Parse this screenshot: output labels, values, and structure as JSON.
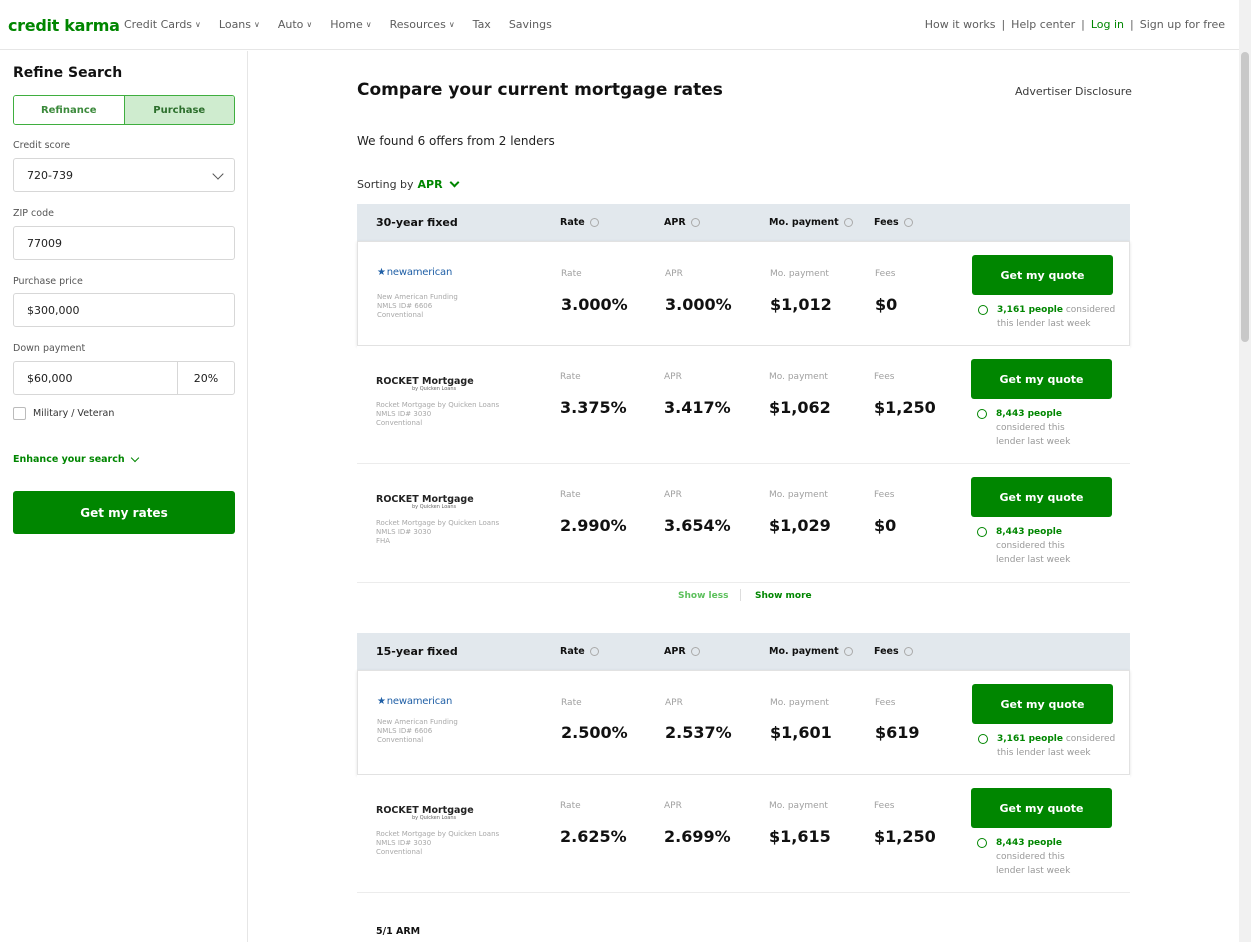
{
  "nav": {
    "logo": "credit karma",
    "items": [
      {
        "label": "Credit Cards",
        "dropdown": true
      },
      {
        "label": "Loans",
        "dropdown": true
      },
      {
        "label": "Auto",
        "dropdown": true
      },
      {
        "label": "Home",
        "dropdown": true
      },
      {
        "label": "Resources",
        "dropdown": true
      },
      {
        "label": "Tax",
        "dropdown": false
      },
      {
        "label": "Savings",
        "dropdown": false
      }
    ],
    "how_it_works": "How it works",
    "help_center": "Help center",
    "login": "Log in",
    "signup": "Sign up for free"
  },
  "sidebar": {
    "title": "Refine Search",
    "toggle_refinance": "Refinance",
    "toggle_purchase": "Purchase",
    "credit_score_label": "Credit score",
    "credit_score_value": "720-739",
    "zip_label": "ZIP code",
    "zip_value": "77009",
    "price_label": "Purchase price",
    "price_value": "$300,000",
    "down_label": "Down payment",
    "down_value": "$60,000",
    "down_pct": "20%",
    "military_label": "Military / Veteran",
    "enhance_label": "Enhance your search",
    "submit_label": "Get my rates"
  },
  "main": {
    "title": "Compare your current mortgage rates",
    "disclosure": "Advertiser Disclosure",
    "found_text": "We found 6 offers from 2 lenders",
    "sorting_label": "Sorting by",
    "sorting_value": "APR",
    "col_rate": "Rate",
    "col_apr": "APR",
    "col_payment": "Mo. payment",
    "col_fees": "Fees",
    "quote_label": "Get my quote",
    "show_less": "Show less",
    "show_more": "Show more",
    "arm_title": "5/1 ARM",
    "sections": [
      {
        "title": "30-year fixed",
        "offers": [
          {
            "logo": "newamerican",
            "lender": "New American Funding",
            "nmls": "NMLS ID# 6606",
            "loan_type": "Conventional",
            "rate": "3.000%",
            "apr": "3.000%",
            "payment": "$1,012",
            "fees": "$0",
            "people": "3,161 people",
            "considered": "considered this lender last week"
          },
          {
            "logo": "ROCKET Mortgage",
            "logo_sub": "by Quicken Loans",
            "lender": "Rocket Mortgage by Quicken Loans",
            "nmls": "NMLS ID# 3030",
            "loan_type": "Conventional",
            "rate": "3.375%",
            "apr": "3.417%",
            "payment": "$1,062",
            "fees": "$1,250",
            "people": "8,443 people",
            "considered": "considered this lender last week"
          },
          {
            "logo": "ROCKET Mortgage",
            "logo_sub": "by Quicken Loans",
            "lender": "Rocket Mortgage by Quicken Loans",
            "nmls": "NMLS ID# 3030",
            "loan_type": "FHA",
            "rate": "2.990%",
            "apr": "3.654%",
            "payment": "$1,029",
            "fees": "$0",
            "people": "8,443 people",
            "considered": "considered this lender last week"
          }
        ]
      },
      {
        "title": "15-year fixed",
        "offers": [
          {
            "logo": "newamerican",
            "lender": "New American Funding",
            "nmls": "NMLS ID# 6606",
            "loan_type": "Conventional",
            "rate": "2.500%",
            "apr": "2.537%",
            "payment": "$1,601",
            "fees": "$619",
            "people": "3,161 people",
            "considered": "considered this lender last week"
          },
          {
            "logo": "ROCKET Mortgage",
            "logo_sub": "by Quicken Loans",
            "lender": "Rocket Mortgage by Quicken Loans",
            "nmls": "NMLS ID# 3030",
            "loan_type": "Conventional",
            "rate": "2.625%",
            "apr": "2.699%",
            "payment": "$1,615",
            "fees": "$1,250",
            "people": "8,443 people",
            "considered": "considered this lender last week"
          }
        ]
      }
    ]
  }
}
